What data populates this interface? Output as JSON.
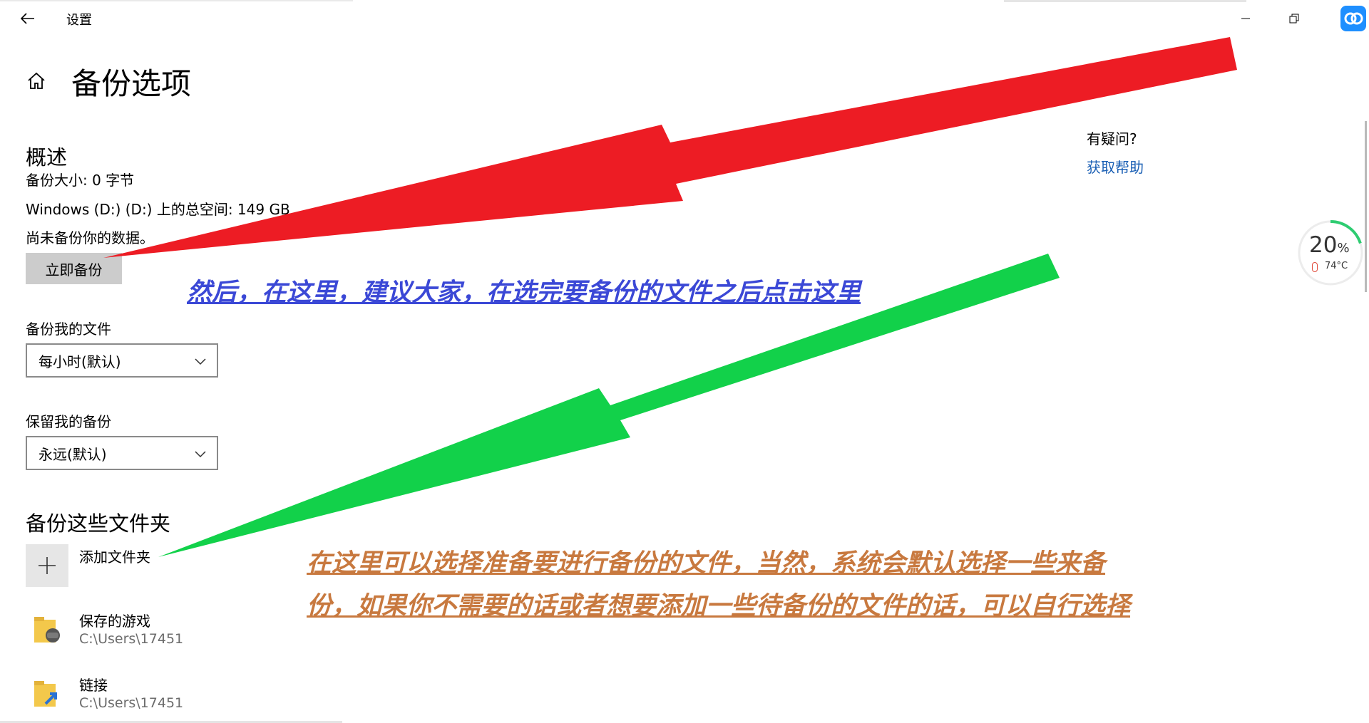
{
  "window": {
    "title": "设置",
    "icons": [
      "back-arrow-icon",
      "minimize-icon",
      "restore-icon",
      "close-icon",
      "cloud-app-icon"
    ]
  },
  "page": {
    "title": "备份选项",
    "home_icon": "home-icon"
  },
  "overview": {
    "heading": "概述",
    "size": "备份大小: 0 字节",
    "total_space": "Windows (D:) (D:) 上的总空间: 149 GB",
    "status": "尚未备份你的数据。",
    "backup_now": "立即备份"
  },
  "backup_files": {
    "label": "备份我的文件",
    "value": "每小时(默认)"
  },
  "keep_backups": {
    "label": "保留我的备份",
    "value": "永远(默认)"
  },
  "folders": {
    "heading": "备份这些文件夹",
    "add_label": "添加文件夹",
    "items": [
      {
        "name": "保存的游戏",
        "path": "C:\\Users\\17451"
      },
      {
        "name": "链接",
        "path": "C:\\Users\\17451"
      }
    ]
  },
  "help": {
    "question": "有疑问?",
    "link": "获取帮助"
  },
  "annotations": {
    "blue": "然后，在这里，建议大家，在选完要备份的文件之后点击这里",
    "orange_line1": "在这里可以选择准备要进行备份的文件，当然，系统会默认选择一些来备",
    "orange_line2": "份，如果你不需要的话或者想要添加一些待备份的文件的话，可以自行选择",
    "colors": {
      "red_arrow": "#ed1c24",
      "green_arrow": "#12d14a",
      "blue_text": "#3b48d6",
      "orange_text": "#c8793f"
    }
  },
  "widget": {
    "percent": "20",
    "percent_sign": "%",
    "temperature": "74°C",
    "level_fraction": 0.2,
    "accent": "#2ecc71"
  }
}
